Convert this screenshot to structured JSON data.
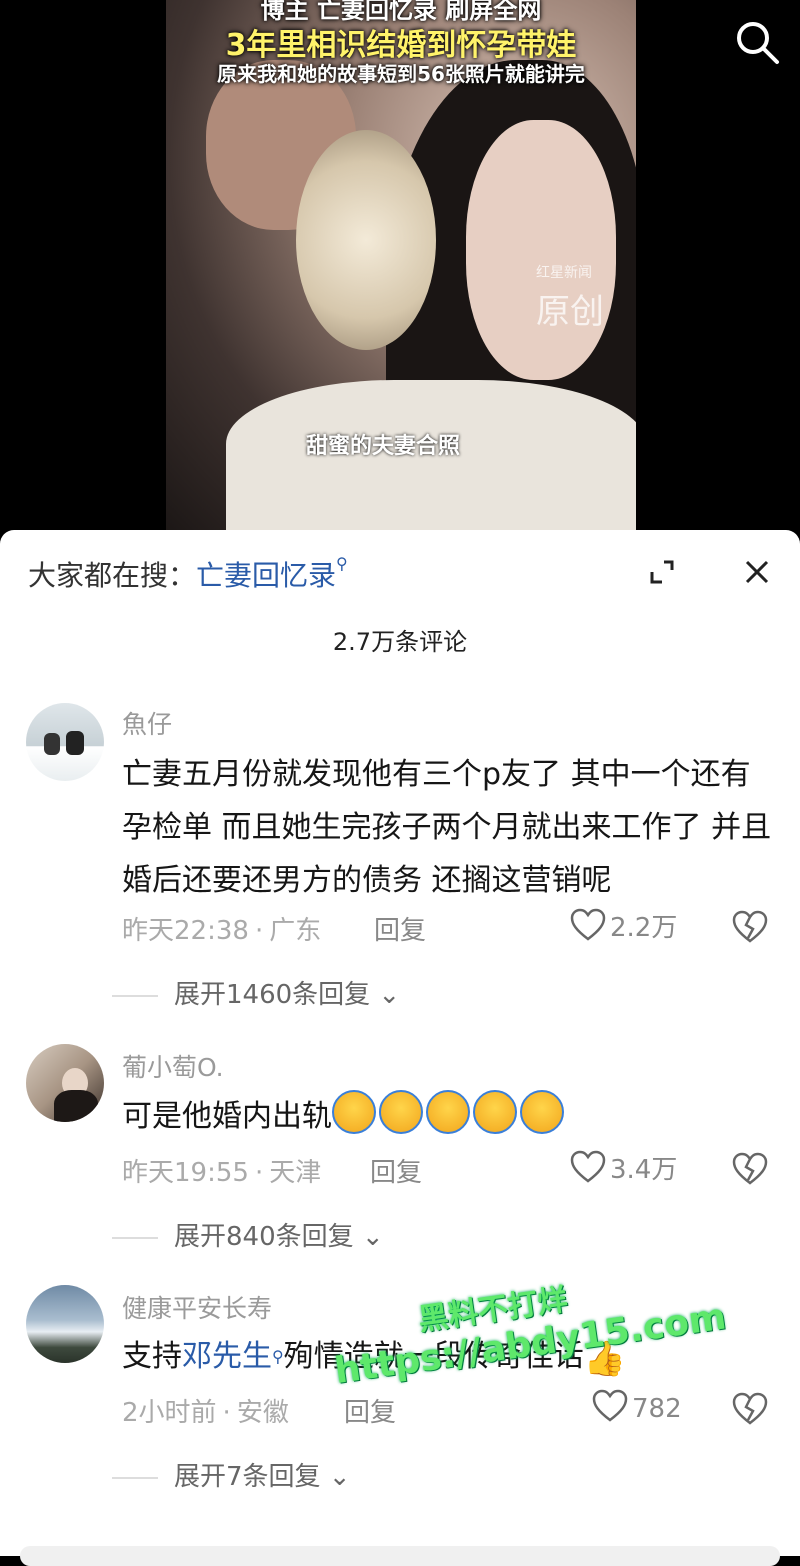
{
  "video": {
    "title_line0": "博主 亡妻回忆录 刷屏全网",
    "title_line1": "3年里相识结婚到怀孕带娃",
    "title_line2": "原来我和她的故事短到56张照片就能讲完",
    "watermark_small": "红星新闻",
    "watermark_big": "原创",
    "caption": "甜蜜的夫妻合照",
    "search_icon": "search-icon"
  },
  "sheet": {
    "trending_prefix": "大家都在搜：",
    "trending_keyword": "亡妻回忆录",
    "comment_count": "2.7万条评论"
  },
  "comments": [
    {
      "name": "魚仔",
      "text": "亡妻五月份就发现他有三个p友了 其中一个还有孕检单 而且她生完孩子两个月就出来工作了 并且婚后还要还男方的债务 还搁这营销呢",
      "time": "昨天22:38",
      "location": "广东",
      "reply": "回复",
      "likes": "2.2万",
      "expand": "展开1460条回复"
    },
    {
      "name": "葡小萄O.",
      "text": "可是他婚内出轨",
      "time": "昨天19:55",
      "location": "天津",
      "reply": "回复",
      "likes": "3.4万",
      "expand": "展开840条回复"
    },
    {
      "name": "健康平安长寿",
      "text_a": "支持",
      "mention": "邓先生",
      "text_b": "殉情造就一段传奇佳话",
      "time": "2小时前",
      "location": "安徽",
      "reply": "回复",
      "likes": "782",
      "expand": "展开7条回复"
    }
  ],
  "overlay": {
    "line1": "黑料不打烊",
    "line2": "https://abdy15.com"
  }
}
